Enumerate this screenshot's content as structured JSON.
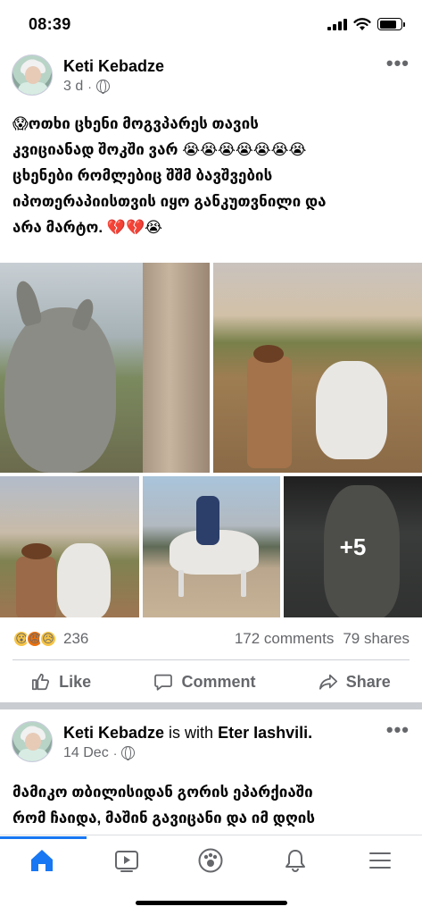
{
  "status_bar": {
    "time": "08:39"
  },
  "post1": {
    "author": "Keti Kebadze",
    "time_ago": "3 d",
    "text_lines": [
      "😱ოთხი ცხენი  მოგვპარეს თავის",
      "კვიციანად  შოკში ვარ 😭😭😭😭😭😭😭",
      "ცხენები რომლებიც შშმ ბავშვების",
      "იპოთერაპიისთვის იყო განკუთვნილი და",
      "არა მარტო. 💔💔😭"
    ],
    "extra_photos": "+5",
    "reaction_emojis": [
      "😮",
      "😡",
      "😥"
    ],
    "reaction_count": "236",
    "comments": "172 comments",
    "shares": "79 shares",
    "actions": {
      "like": "Like",
      "comment": "Comment",
      "share": "Share"
    }
  },
  "post2": {
    "author": "Keti Kebadze",
    "with_text": "is with",
    "tagged": "Eter Iashvili.",
    "date": "14 Dec",
    "text_lines": [
      "მამიკო  თბილისიდან გორის ეპარქიაში",
      "რომ  ჩაიდა, მაშინ გავიცანი და იმ დღის"
    ]
  },
  "tabbar": {
    "items": [
      "home-icon",
      "video-icon",
      "groups-icon",
      "notifications-icon",
      "menu-icon"
    ],
    "active_color": "#1877f2"
  }
}
